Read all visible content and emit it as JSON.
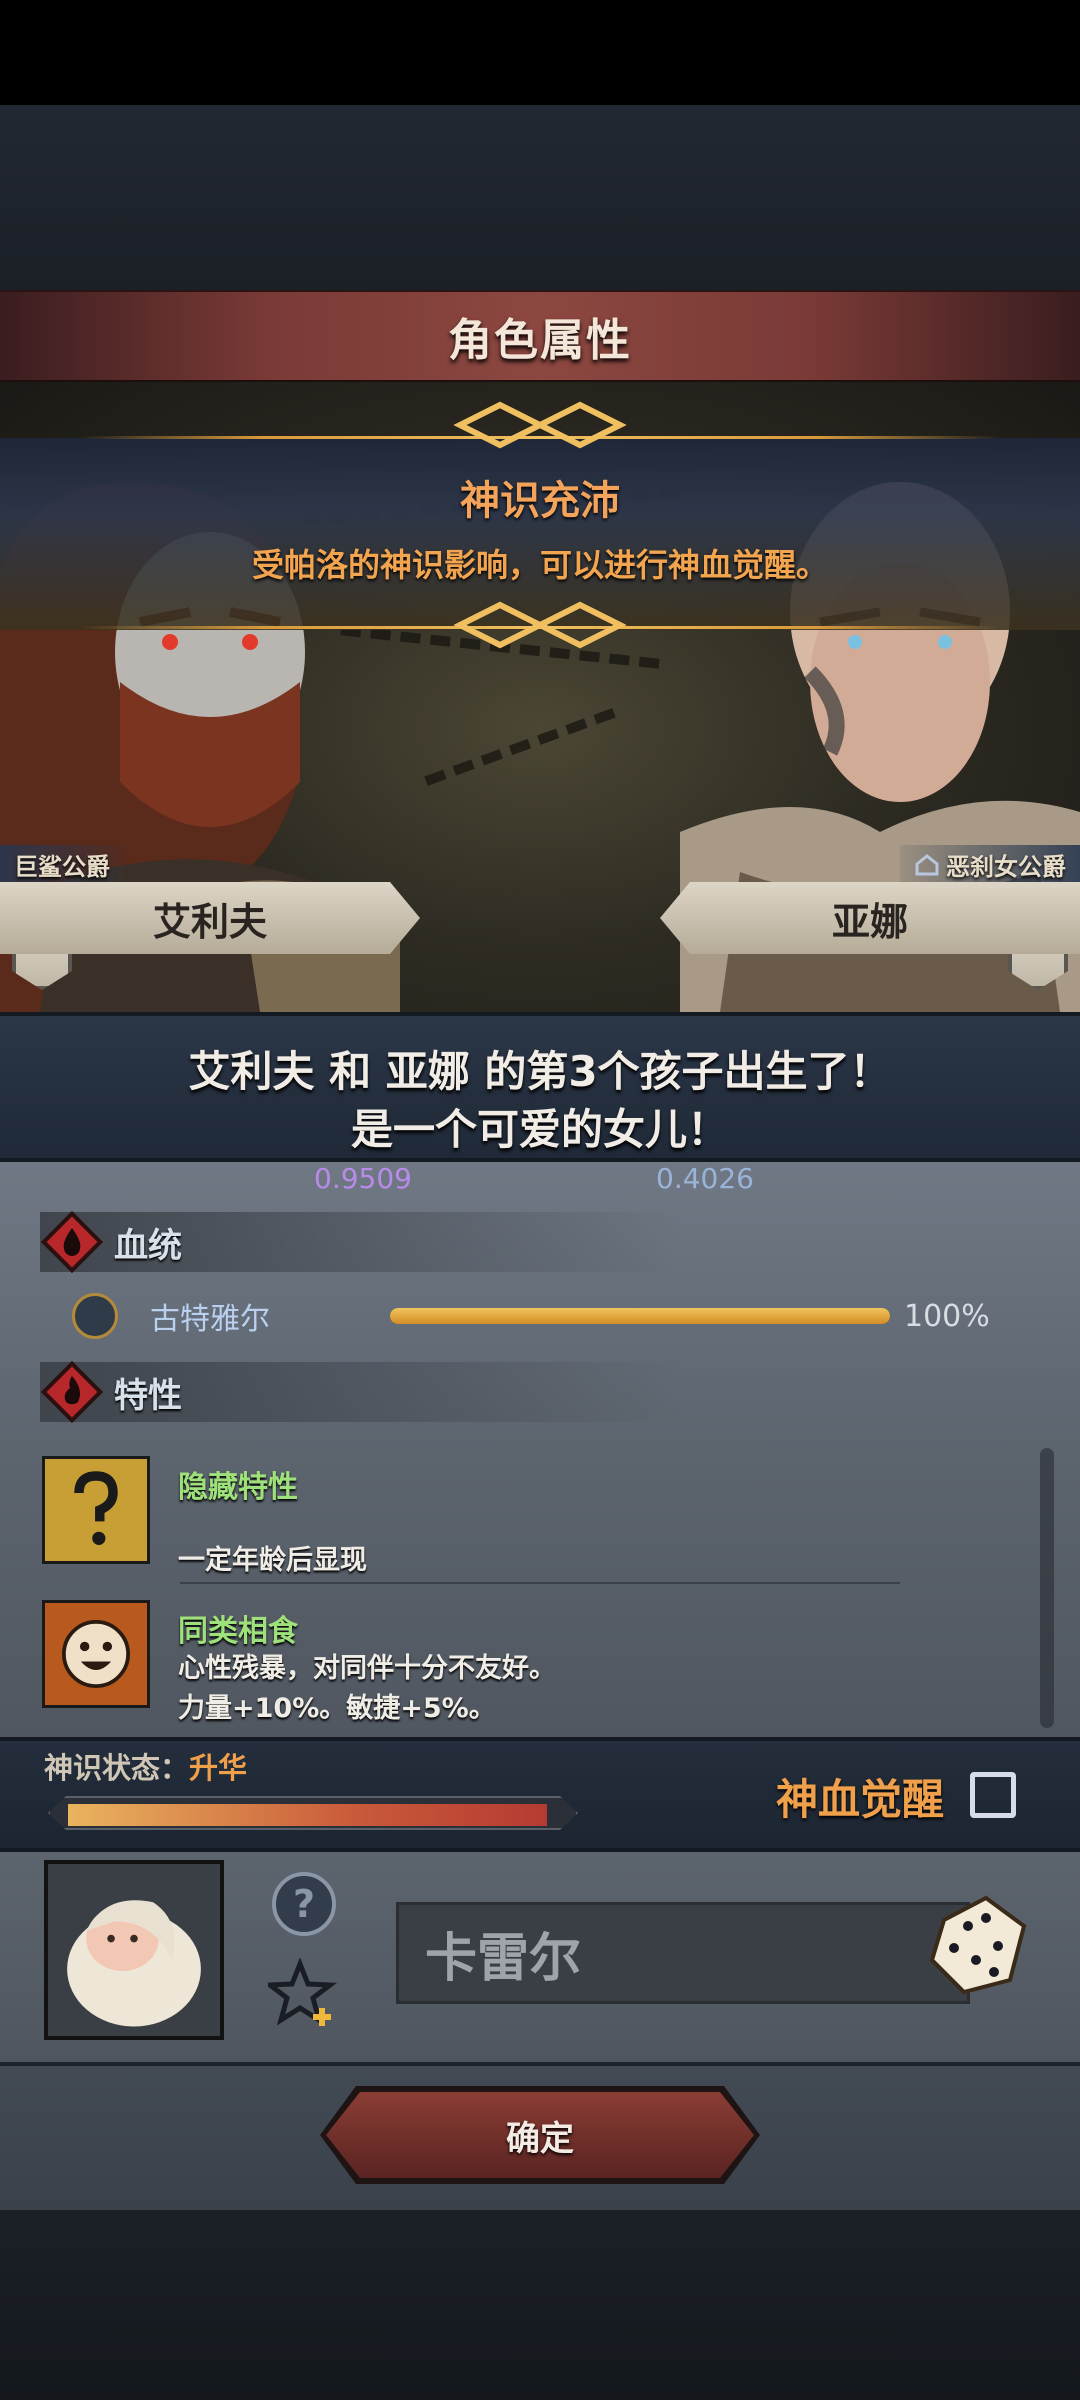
{
  "header": {
    "title": "角色属性"
  },
  "banner": {
    "title": "神识充沛",
    "subtitle": "受帕洛的神识影响，可以进行神血觉醒。"
  },
  "parents": {
    "left": {
      "role": "巨鲨公爵",
      "name": "艾利夫"
    },
    "right": {
      "role": "恶刹女公爵",
      "name": "亚娜"
    }
  },
  "announcement": {
    "line1": "艾利夫 和 亚娜 的第3个孩子出生了！",
    "line2": "是一个可爱的女儿！"
  },
  "stats": {
    "left_value": "0.9509",
    "right_value": "0.4026"
  },
  "bloodline": {
    "label": "血统",
    "entries": [
      {
        "name": "古特雅尔",
        "percent_text": "100%",
        "percent": 1.0
      }
    ]
  },
  "traits": {
    "label": "特性",
    "items": [
      {
        "name": "隐藏特性",
        "icon": "question-mark-icon",
        "desc1": "",
        "desc2": "一定年龄后显现"
      },
      {
        "name": "同类相食",
        "icon": "smiling-face-icon",
        "desc1": "心性残暴，对同伴十分不友好。",
        "desc2": "力量+10%。敏捷+5%。"
      }
    ]
  },
  "divine_state": {
    "label": "神识状态：",
    "value": "升华",
    "level": 0.97
  },
  "awaken": {
    "label": "神血觉醒",
    "checked": false
  },
  "child": {
    "name_value": "卡雷尔"
  },
  "confirm": {
    "label": "确定"
  },
  "colors": {
    "accent_orange": "#f0a04a",
    "trait_green": "#9ee07a",
    "title_red": "#8c4740"
  }
}
